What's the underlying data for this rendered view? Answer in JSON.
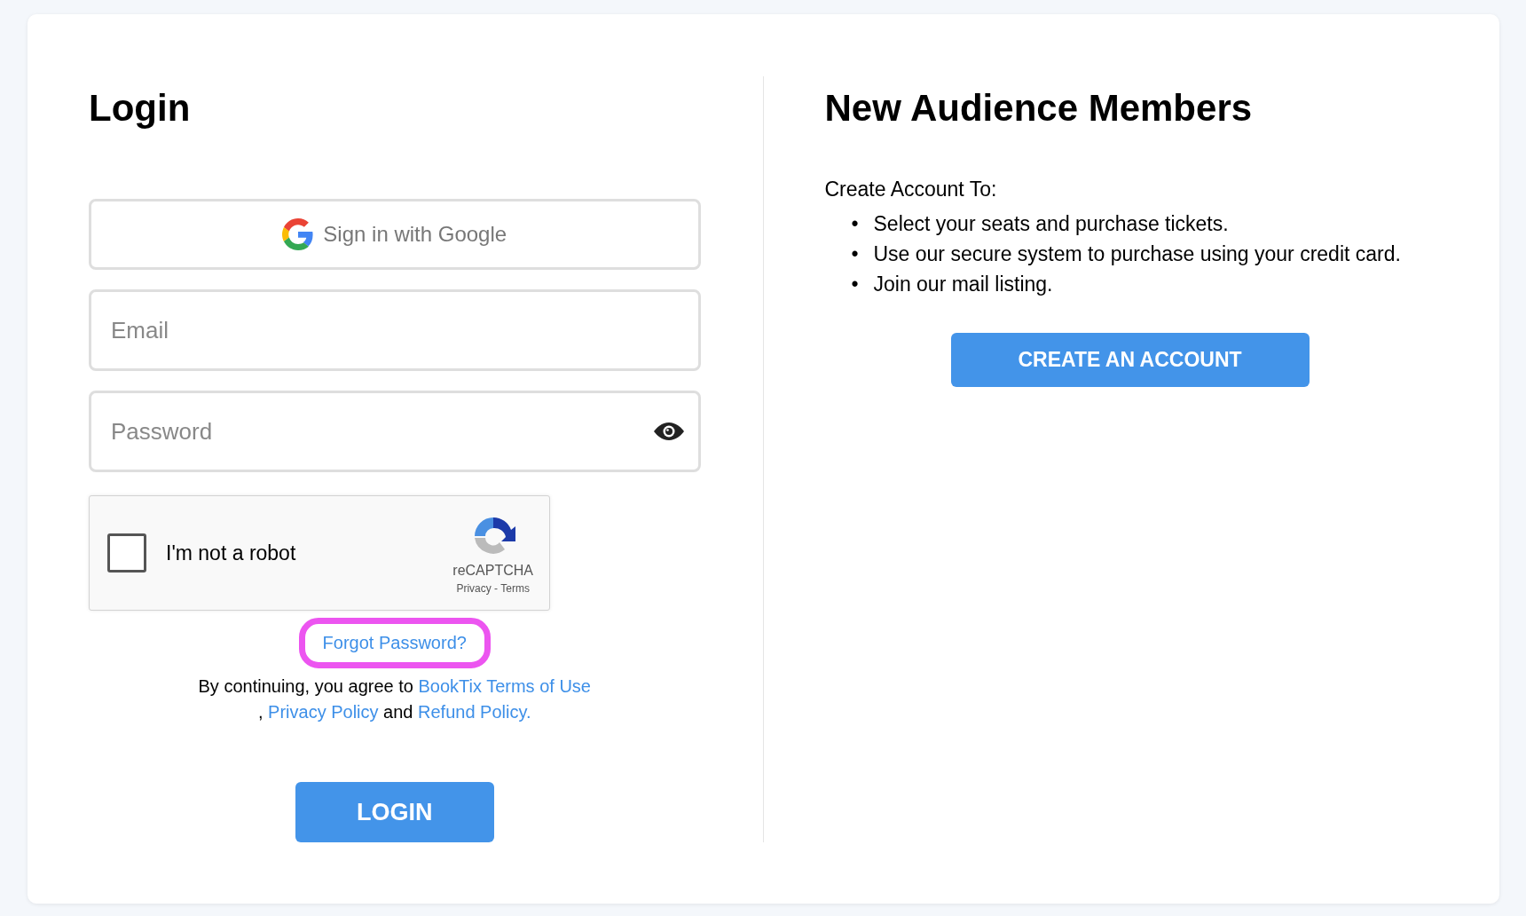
{
  "login": {
    "title": "Login",
    "google_button": {
      "label": "Sign in with Google"
    },
    "email": {
      "placeholder": "Email"
    },
    "password": {
      "placeholder": "Password"
    },
    "captcha": {
      "label": "I'm not a robot",
      "checked": false,
      "brand": "reCAPTCHA",
      "links": "Privacy - Terms"
    },
    "forgot_link": {
      "label": "Forgot Password?",
      "highlighted": true
    },
    "terms": [
      [
        {
          "kind": "text",
          "text": "By continuing, you agree to "
        },
        {
          "kind": "link",
          "text": "BookTix Terms of Use"
        }
      ],
      [
        {
          "kind": "text",
          "text": ", "
        },
        {
          "kind": "link",
          "text": "Privacy Policy"
        },
        {
          "kind": "text",
          "text": " and "
        },
        {
          "kind": "link",
          "text": "Refund Policy."
        }
      ]
    ],
    "submit": {
      "label": "LOGIN"
    }
  },
  "signup": {
    "title": "New Audience Members",
    "intro": "Create Account To:",
    "benefits": [
      {
        "marker": "•",
        "text": "Select your seats and purchase tickets."
      },
      {
        "marker": "•",
        "text": "Use our secure system to purchase using your credit card."
      },
      {
        "marker": "•",
        "text": "Join our mail listing."
      }
    ],
    "button": {
      "label": "CREATE AN ACCOUNT"
    }
  }
}
